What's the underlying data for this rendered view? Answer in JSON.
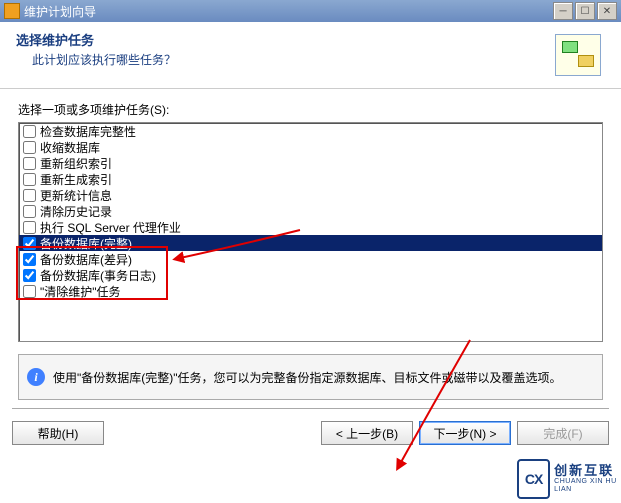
{
  "window": {
    "title": "维护计划向导"
  },
  "header": {
    "title": "选择维护任务",
    "subtitle": "此计划应该执行哪些任务？"
  },
  "list": {
    "label": "选择一项或多项维护任务(S):",
    "items": [
      {
        "label": "检查数据库完整性",
        "checked": false,
        "selected": false
      },
      {
        "label": "收缩数据库",
        "checked": false,
        "selected": false
      },
      {
        "label": "重新组织索引",
        "checked": false,
        "selected": false
      },
      {
        "label": "重新生成索引",
        "checked": false,
        "selected": false
      },
      {
        "label": "更新统计信息",
        "checked": false,
        "selected": false
      },
      {
        "label": "清除历史记录",
        "checked": false,
        "selected": false
      },
      {
        "label": "执行 SQL Server 代理作业",
        "checked": false,
        "selected": false
      },
      {
        "label": "备份数据库(完整)",
        "checked": true,
        "selected": true
      },
      {
        "label": "备份数据库(差异)",
        "checked": true,
        "selected": false
      },
      {
        "label": "备份数据库(事务日志)",
        "checked": true,
        "selected": false
      },
      {
        "label": "\"清除维护\"任务",
        "checked": false,
        "selected": false
      }
    ]
  },
  "info": {
    "text": "使用\"备份数据库(完整)\"任务，您可以为完整备份指定源数据库、目标文件或磁带以及覆盖选项。"
  },
  "buttons": {
    "help": "帮助(H)",
    "back": "< 上一步(B)",
    "next": "下一步(N) >",
    "finish": "完成(F)"
  },
  "watermark": {
    "logo": "CX",
    "cn": "创新互联",
    "en": "CHUANG XIN HU LIAN"
  }
}
